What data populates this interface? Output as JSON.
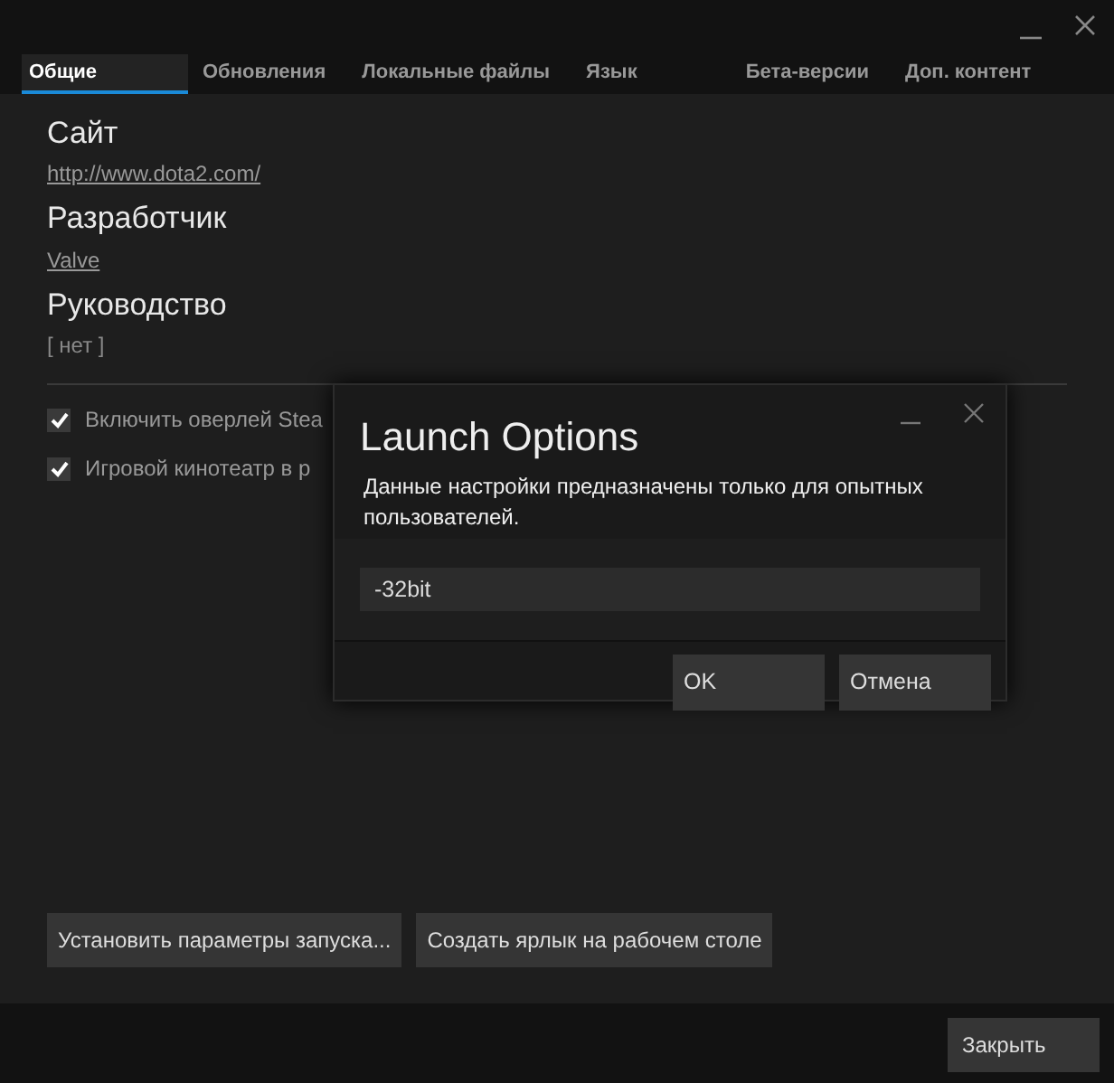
{
  "tabs": [
    {
      "label": "Общие",
      "selected": true
    },
    {
      "label": "Обновления",
      "selected": false
    },
    {
      "label": "Локальные файлы",
      "selected": false
    },
    {
      "label": "Язык",
      "selected": false
    },
    {
      "label": "Бета-версии",
      "selected": false
    },
    {
      "label": "Доп. контент",
      "selected": false
    }
  ],
  "info": [
    {
      "heading": "Сайт",
      "value": "http://www.dota2.com/",
      "kind": "link"
    },
    {
      "heading": "Разработчик",
      "value": "Valve",
      "kind": "link"
    },
    {
      "heading": "Руководство",
      "value": "[ нет ]",
      "kind": "text"
    }
  ],
  "options": [
    {
      "label": "Включить оверлей Stea",
      "checked": true
    },
    {
      "label": "Игровой кинотеатр в р",
      "checked": true
    }
  ],
  "actions": [
    "Установить параметры запуска...",
    "Создать ярлык на рабочем столе"
  ],
  "footer": {
    "close": "Закрыть"
  },
  "dialog": {
    "title": "Launch Options",
    "description": "Данные настройки предназначены только для опытных пользователей.",
    "value": "-32bit",
    "buttons": [
      "OK",
      "Отмена"
    ]
  }
}
